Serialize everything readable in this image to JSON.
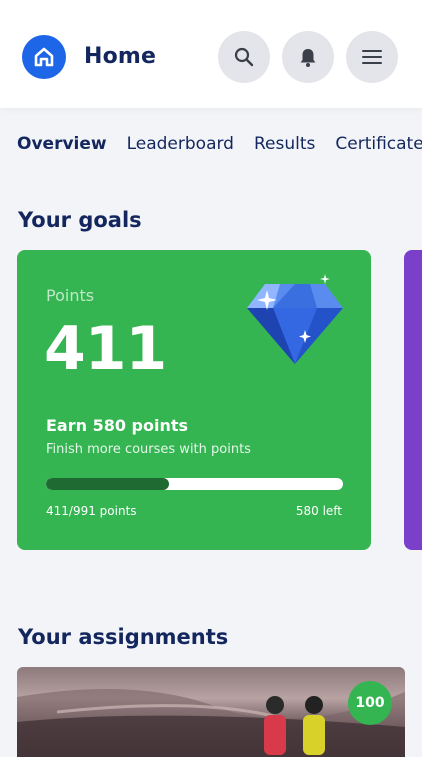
{
  "header": {
    "title": "Home",
    "icons": [
      "home-icon",
      "search-icon",
      "bell-icon",
      "menu-icon"
    ]
  },
  "tabs": [
    {
      "label": "Overview",
      "active": true
    },
    {
      "label": "Leaderboard",
      "active": false
    },
    {
      "label": "Results",
      "active": false
    },
    {
      "label": "Certificates",
      "active": false
    }
  ],
  "goals": {
    "section_title": "Your goals",
    "points_label": "Points",
    "points_value": "411",
    "earn_title": "Earn 580 points",
    "earn_subtitle": "Finish more courses with points",
    "progress_text": "411/991 points",
    "remaining_text": "580 left",
    "progress_fraction": 0.415,
    "card_color": "#34b551",
    "next_card_color": "#7a40c9"
  },
  "assignments": {
    "section_title": "Your assignments",
    "badge_value": "100"
  }
}
